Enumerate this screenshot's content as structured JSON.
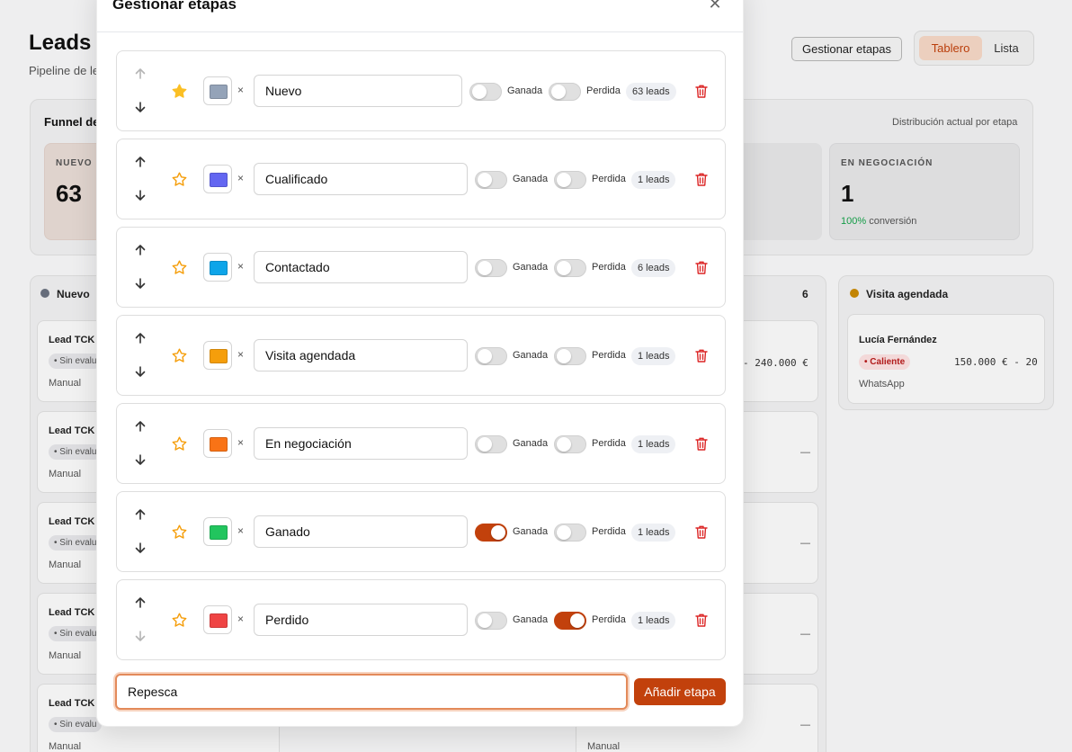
{
  "background": {
    "page_title": "Leads",
    "page_subtitle": "Pipeline de le",
    "manage_button": "Gestionar etapas",
    "view_board": "Tablero",
    "view_list": "Lista",
    "funnel_title": "Funnel de",
    "funnel_note": "Distribución actual por etapa",
    "funnel_new_label": "NUEVO",
    "funnel_new_value": "63",
    "funnel_neg_label": "EN NEGOCIACIÓN",
    "funnel_neg_value": "1",
    "funnel_neg_conv_pct": "100%",
    "funnel_neg_conv_text": " conversión",
    "col_new_title": "Nuevo",
    "col_mid_count": "6",
    "col_visit_title": "Visita agendada",
    "lead_name": "Lead TCK",
    "lead_chip": "• Sin evalu",
    "lead_source": "Manual",
    "dash": "—",
    "mid_price": "- 240.000 €",
    "lucia_name": "Lucía Fernández",
    "lucia_chip": "• Caliente",
    "lucia_price": "150.000 € - 20",
    "lucia_source": "WhatsApp",
    "colors": {
      "accent": "#c2410c",
      "new_dot": "#6b7280",
      "visit_dot": "#ca8a04"
    }
  },
  "modal": {
    "title": "Gestionar etapas",
    "won_label": "Ganada",
    "lost_label": "Perdida",
    "stages": [
      {
        "name": "Nuevo",
        "color": "#94a3b8",
        "starred": true,
        "won": false,
        "lost": false,
        "count": "63 leads"
      },
      {
        "name": "Cualificado",
        "color": "#6366f1",
        "starred": false,
        "won": false,
        "lost": false,
        "count": "1 leads"
      },
      {
        "name": "Contactado",
        "color": "#0ea5e9",
        "starred": false,
        "won": false,
        "lost": false,
        "count": "6 leads"
      },
      {
        "name": "Visita agendada",
        "color": "#f59e0b",
        "starred": false,
        "won": false,
        "lost": false,
        "count": "1 leads"
      },
      {
        "name": "En negociación",
        "color": "#f97316",
        "starred": false,
        "won": false,
        "lost": false,
        "count": "1 leads"
      },
      {
        "name": "Ganado",
        "color": "#22c55e",
        "starred": false,
        "won": true,
        "lost": false,
        "count": "1 leads"
      },
      {
        "name": "Perdido",
        "color": "#ef4444",
        "starred": false,
        "won": false,
        "lost": true,
        "count": "1 leads"
      }
    ],
    "new_stage_value": "Repesca",
    "add_button": "Añadir etapa"
  }
}
